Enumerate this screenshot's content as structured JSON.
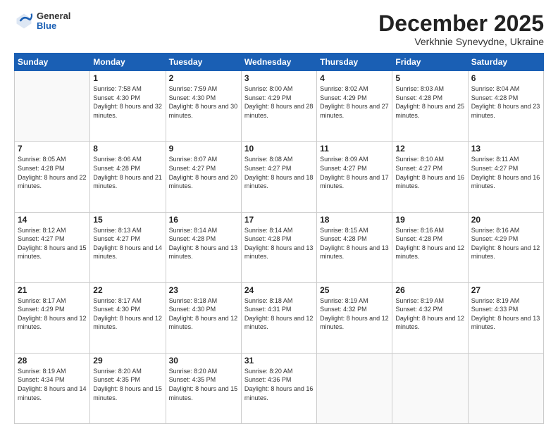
{
  "header": {
    "logo": {
      "general": "General",
      "blue": "Blue"
    },
    "month": "December 2025",
    "location": "Verkhnie Synevydne, Ukraine"
  },
  "weekdays": [
    "Sunday",
    "Monday",
    "Tuesday",
    "Wednesday",
    "Thursday",
    "Friday",
    "Saturday"
  ],
  "weeks": [
    [
      {
        "day": "",
        "sunrise": "",
        "sunset": "",
        "daylight": ""
      },
      {
        "day": "1",
        "sunrise": "Sunrise: 7:58 AM",
        "sunset": "Sunset: 4:30 PM",
        "daylight": "Daylight: 8 hours and 32 minutes."
      },
      {
        "day": "2",
        "sunrise": "Sunrise: 7:59 AM",
        "sunset": "Sunset: 4:30 PM",
        "daylight": "Daylight: 8 hours and 30 minutes."
      },
      {
        "day": "3",
        "sunrise": "Sunrise: 8:00 AM",
        "sunset": "Sunset: 4:29 PM",
        "daylight": "Daylight: 8 hours and 28 minutes."
      },
      {
        "day": "4",
        "sunrise": "Sunrise: 8:02 AM",
        "sunset": "Sunset: 4:29 PM",
        "daylight": "Daylight: 8 hours and 27 minutes."
      },
      {
        "day": "5",
        "sunrise": "Sunrise: 8:03 AM",
        "sunset": "Sunset: 4:28 PM",
        "daylight": "Daylight: 8 hours and 25 minutes."
      },
      {
        "day": "6",
        "sunrise": "Sunrise: 8:04 AM",
        "sunset": "Sunset: 4:28 PM",
        "daylight": "Daylight: 8 hours and 23 minutes."
      }
    ],
    [
      {
        "day": "7",
        "sunrise": "Sunrise: 8:05 AM",
        "sunset": "Sunset: 4:28 PM",
        "daylight": "Daylight: 8 hours and 22 minutes."
      },
      {
        "day": "8",
        "sunrise": "Sunrise: 8:06 AM",
        "sunset": "Sunset: 4:28 PM",
        "daylight": "Daylight: 8 hours and 21 minutes."
      },
      {
        "day": "9",
        "sunrise": "Sunrise: 8:07 AM",
        "sunset": "Sunset: 4:27 PM",
        "daylight": "Daylight: 8 hours and 20 minutes."
      },
      {
        "day": "10",
        "sunrise": "Sunrise: 8:08 AM",
        "sunset": "Sunset: 4:27 PM",
        "daylight": "Daylight: 8 hours and 18 minutes."
      },
      {
        "day": "11",
        "sunrise": "Sunrise: 8:09 AM",
        "sunset": "Sunset: 4:27 PM",
        "daylight": "Daylight: 8 hours and 17 minutes."
      },
      {
        "day": "12",
        "sunrise": "Sunrise: 8:10 AM",
        "sunset": "Sunset: 4:27 PM",
        "daylight": "Daylight: 8 hours and 16 minutes."
      },
      {
        "day": "13",
        "sunrise": "Sunrise: 8:11 AM",
        "sunset": "Sunset: 4:27 PM",
        "daylight": "Daylight: 8 hours and 16 minutes."
      }
    ],
    [
      {
        "day": "14",
        "sunrise": "Sunrise: 8:12 AM",
        "sunset": "Sunset: 4:27 PM",
        "daylight": "Daylight: 8 hours and 15 minutes."
      },
      {
        "day": "15",
        "sunrise": "Sunrise: 8:13 AM",
        "sunset": "Sunset: 4:27 PM",
        "daylight": "Daylight: 8 hours and 14 minutes."
      },
      {
        "day": "16",
        "sunrise": "Sunrise: 8:14 AM",
        "sunset": "Sunset: 4:28 PM",
        "daylight": "Daylight: 8 hours and 13 minutes."
      },
      {
        "day": "17",
        "sunrise": "Sunrise: 8:14 AM",
        "sunset": "Sunset: 4:28 PM",
        "daylight": "Daylight: 8 hours and 13 minutes."
      },
      {
        "day": "18",
        "sunrise": "Sunrise: 8:15 AM",
        "sunset": "Sunset: 4:28 PM",
        "daylight": "Daylight: 8 hours and 13 minutes."
      },
      {
        "day": "19",
        "sunrise": "Sunrise: 8:16 AM",
        "sunset": "Sunset: 4:28 PM",
        "daylight": "Daylight: 8 hours and 12 minutes."
      },
      {
        "day": "20",
        "sunrise": "Sunrise: 8:16 AM",
        "sunset": "Sunset: 4:29 PM",
        "daylight": "Daylight: 8 hours and 12 minutes."
      }
    ],
    [
      {
        "day": "21",
        "sunrise": "Sunrise: 8:17 AM",
        "sunset": "Sunset: 4:29 PM",
        "daylight": "Daylight: 8 hours and 12 minutes."
      },
      {
        "day": "22",
        "sunrise": "Sunrise: 8:17 AM",
        "sunset": "Sunset: 4:30 PM",
        "daylight": "Daylight: 8 hours and 12 minutes."
      },
      {
        "day": "23",
        "sunrise": "Sunrise: 8:18 AM",
        "sunset": "Sunset: 4:30 PM",
        "daylight": "Daylight: 8 hours and 12 minutes."
      },
      {
        "day": "24",
        "sunrise": "Sunrise: 8:18 AM",
        "sunset": "Sunset: 4:31 PM",
        "daylight": "Daylight: 8 hours and 12 minutes."
      },
      {
        "day": "25",
        "sunrise": "Sunrise: 8:19 AM",
        "sunset": "Sunset: 4:32 PM",
        "daylight": "Daylight: 8 hours and 12 minutes."
      },
      {
        "day": "26",
        "sunrise": "Sunrise: 8:19 AM",
        "sunset": "Sunset: 4:32 PM",
        "daylight": "Daylight: 8 hours and 12 minutes."
      },
      {
        "day": "27",
        "sunrise": "Sunrise: 8:19 AM",
        "sunset": "Sunset: 4:33 PM",
        "daylight": "Daylight: 8 hours and 13 minutes."
      }
    ],
    [
      {
        "day": "28",
        "sunrise": "Sunrise: 8:19 AM",
        "sunset": "Sunset: 4:34 PM",
        "daylight": "Daylight: 8 hours and 14 minutes."
      },
      {
        "day": "29",
        "sunrise": "Sunrise: 8:20 AM",
        "sunset": "Sunset: 4:35 PM",
        "daylight": "Daylight: 8 hours and 15 minutes."
      },
      {
        "day": "30",
        "sunrise": "Sunrise: 8:20 AM",
        "sunset": "Sunset: 4:35 PM",
        "daylight": "Daylight: 8 hours and 15 minutes."
      },
      {
        "day": "31",
        "sunrise": "Sunrise: 8:20 AM",
        "sunset": "Sunset: 4:36 PM",
        "daylight": "Daylight: 8 hours and 16 minutes."
      },
      {
        "day": "",
        "sunrise": "",
        "sunset": "",
        "daylight": ""
      },
      {
        "day": "",
        "sunrise": "",
        "sunset": "",
        "daylight": ""
      },
      {
        "day": "",
        "sunrise": "",
        "sunset": "",
        "daylight": ""
      }
    ]
  ]
}
